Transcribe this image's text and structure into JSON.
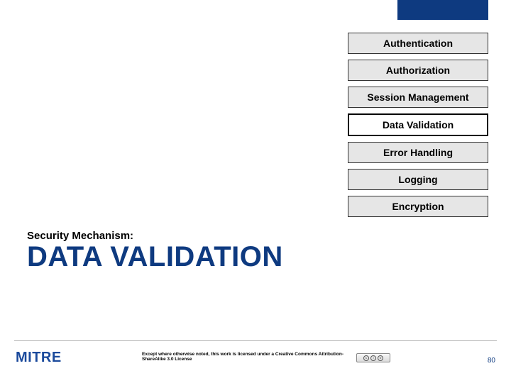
{
  "menu": {
    "items": [
      {
        "label": "Authentication",
        "active": false
      },
      {
        "label": "Authorization",
        "active": false
      },
      {
        "label": "Session Management",
        "active": false
      },
      {
        "label": "Data Validation",
        "active": true
      },
      {
        "label": "Error Handling",
        "active": false
      },
      {
        "label": "Logging",
        "active": false
      },
      {
        "label": "Encryption",
        "active": false
      }
    ]
  },
  "section_label": "Security Mechanism:",
  "title": "DATA VALIDATION",
  "footer": {
    "logo": "MITRE",
    "license": "Except where otherwise noted, this work is licensed under a Creative Commons Attribution-ShareAlike 3.0 License",
    "page_number": "80"
  }
}
